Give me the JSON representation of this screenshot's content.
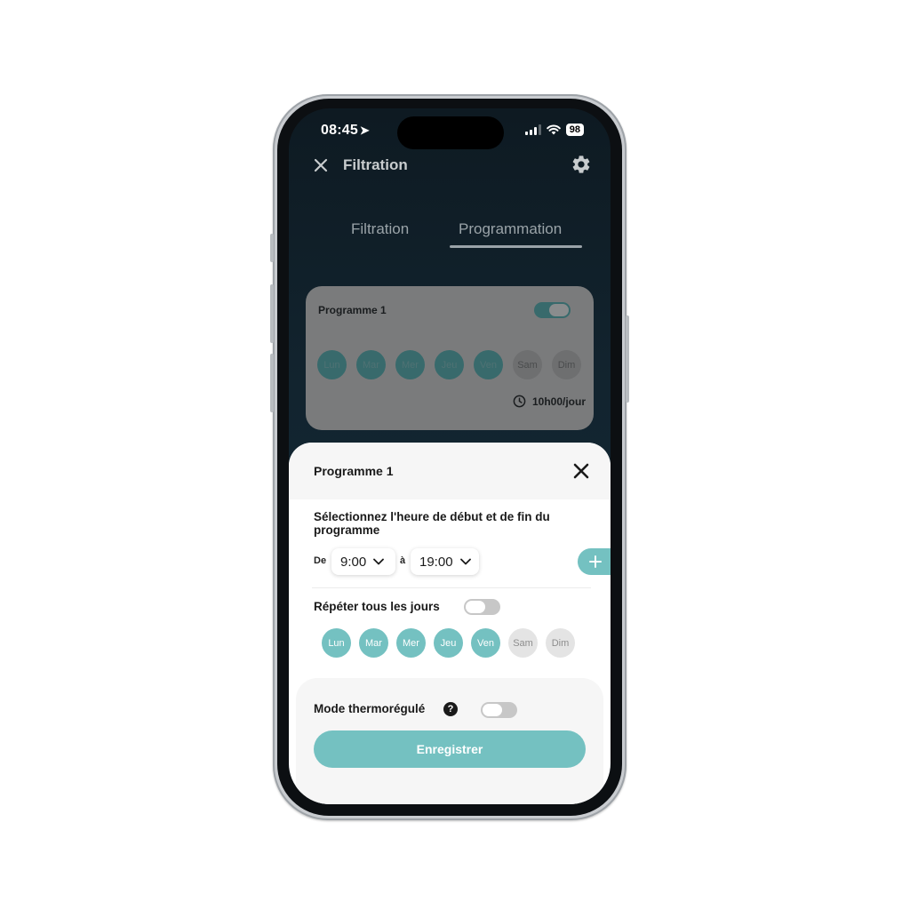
{
  "status_bar": {
    "time": "08:45",
    "location_glyph": "➤",
    "battery": "98"
  },
  "header": {
    "title": "Filtration",
    "close_icon": "close-icon",
    "settings_icon": "gear-icon"
  },
  "tabs": [
    {
      "label": "Filtration",
      "active": false
    },
    {
      "label": "Programmation",
      "active": true
    }
  ],
  "program_card": {
    "title": "Programme 1",
    "enabled": true,
    "days": [
      {
        "label": "Lun",
        "active": true
      },
      {
        "label": "Mar",
        "active": true
      },
      {
        "label": "Mer",
        "active": true
      },
      {
        "label": "Jeu",
        "active": true
      },
      {
        "label": "Ven",
        "active": true
      },
      {
        "label": "Sam",
        "active": false
      },
      {
        "label": "Dim",
        "active": false
      }
    ],
    "duration": "10h00/jour"
  },
  "sheet": {
    "title": "Programme 1",
    "question": "Sélectionnez l'heure de début et de fin du programme",
    "from_label": "De",
    "from_value": "9:00",
    "to_label": "à",
    "to_value": "19:00",
    "add_label": "+",
    "repeat_label": "Répéter tous les jours",
    "repeat_enabled": false,
    "days": [
      {
        "label": "Lun",
        "active": true
      },
      {
        "label": "Mar",
        "active": true
      },
      {
        "label": "Mer",
        "active": true
      },
      {
        "label": "Jeu",
        "active": true
      },
      {
        "label": "Ven",
        "active": true
      },
      {
        "label": "Sam",
        "active": false
      },
      {
        "label": "Dim",
        "active": false
      }
    ],
    "mode_label": "Mode thermorégulé",
    "help_glyph": "?",
    "mode_enabled": false,
    "save_label": "Enregistrer"
  },
  "colors": {
    "accent": "#74c1c1",
    "accent_dimmed": "#386a6c",
    "background_dark": "#0e1a22",
    "inactive_day": "#e4e4e4"
  }
}
